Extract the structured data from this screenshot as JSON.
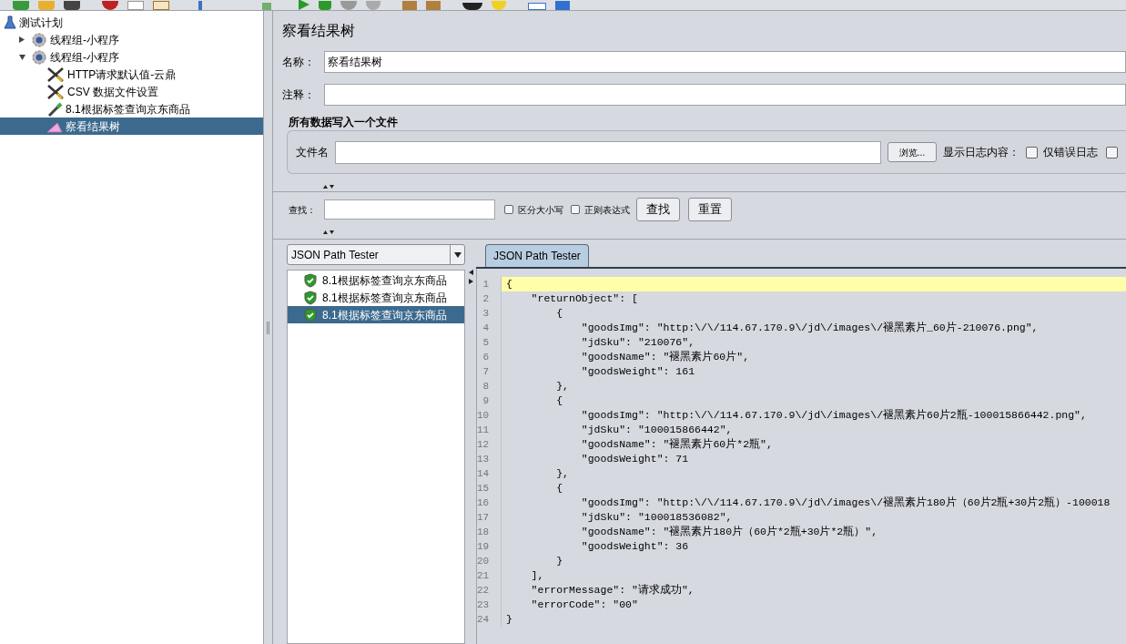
{
  "tree": [
    {
      "label": "测试计划",
      "kind": "plan",
      "selected": false,
      "children": [
        {
          "label": "线程组-小程序",
          "kind": "thread-group",
          "selected": false,
          "expanded": false
        },
        {
          "label": "线程组-小程序",
          "kind": "thread-group",
          "selected": false,
          "expanded": true,
          "children": [
            {
              "label": "HTTP请求默认值-云鼎",
              "kind": "config",
              "selected": false
            },
            {
              "label": "CSV 数据文件设置",
              "kind": "config",
              "selected": false
            },
            {
              "label": "8.1根据标签查询京东商品",
              "kind": "sampler",
              "selected": false
            },
            {
              "label": "察看结果树",
              "kind": "listener",
              "selected": true
            }
          ]
        }
      ]
    }
  ],
  "panel": {
    "title": "察看结果树",
    "name_field": {
      "label": "名称：",
      "value": "察看结果树"
    },
    "comment_field": {
      "label": "注释："
    },
    "file_section": {
      "title": "所有数据写入一个文件",
      "filename_label": "文件名",
      "browse_button": "浏览...",
      "log_label": "显示日志内容：",
      "checkboxes": [
        {
          "label": "仅错误日志",
          "checked": false
        },
        {
          "checked": false
        }
      ]
    },
    "search": {
      "label": "查找：",
      "checkboxes": [
        {
          "label": "区分大小写",
          "checked": false
        },
        {
          "label": "正则表达式",
          "checked": false
        }
      ],
      "buttons": [
        "查找",
        "重置"
      ]
    },
    "renderer_select": "JSON Path Tester",
    "results": [
      {
        "label": "8.1根据标签查询京东商品",
        "selected": false
      },
      {
        "label": "8.1根据标签查询京东商品",
        "selected": false
      },
      {
        "label": "8.1根据标签查询京东商品",
        "selected": true
      }
    ],
    "tabs": [
      {
        "label": "JSON Path Tester",
        "selected": true
      }
    ],
    "code_lines": [
      {
        "number": "1",
        "text": "{",
        "highlighted": true
      },
      {
        "number": "2",
        "text": "    \"returnObject\": [",
        "highlighted": false
      },
      {
        "number": "3",
        "text": "        {",
        "highlighted": false
      },
      {
        "number": "4",
        "text": "            \"goodsImg\": \"http:\\/\\/114.67.170.9\\/jd\\/images\\/褪黑素片_60片-210076.png\",",
        "highlighted": false
      },
      {
        "number": "5",
        "text": "            \"jdSku\": \"210076\",",
        "highlighted": false
      },
      {
        "number": "6",
        "text": "            \"goodsName\": \"褪黑素片60片\",",
        "highlighted": false
      },
      {
        "number": "7",
        "text": "            \"goodsWeight\": 161",
        "highlighted": false
      },
      {
        "number": "8",
        "text": "        },",
        "highlighted": false
      },
      {
        "number": "9",
        "text": "        {",
        "highlighted": false
      },
      {
        "number": "10",
        "text": "            \"goodsImg\": \"http:\\/\\/114.67.170.9\\/jd\\/images\\/褪黑素片60片2瓶-100015866442.png\",",
        "highlighted": false
      },
      {
        "number": "11",
        "text": "            \"jdSku\": \"100015866442\",",
        "highlighted": false
      },
      {
        "number": "12",
        "text": "            \"goodsName\": \"褪黑素片60片*2瓶\",",
        "highlighted": false
      },
      {
        "number": "13",
        "text": "            \"goodsWeight\": 71",
        "highlighted": false
      },
      {
        "number": "14",
        "text": "        },",
        "highlighted": false
      },
      {
        "number": "15",
        "text": "        {",
        "highlighted": false
      },
      {
        "number": "16",
        "text": "            \"goodsImg\": \"http:\\/\\/114.67.170.9\\/jd\\/images\\/褪黑素片180片（60片2瓶+30片2瓶）-100018",
        "highlighted": false
      },
      {
        "number": "17",
        "text": "            \"jdSku\": \"100018536082\",",
        "highlighted": false
      },
      {
        "number": "18",
        "text": "            \"goodsName\": \"褪黑素片180片（60片*2瓶+30片*2瓶）\",",
        "highlighted": false
      },
      {
        "number": "19",
        "text": "            \"goodsWeight\": 36",
        "highlighted": false
      },
      {
        "number": "20",
        "text": "        }",
        "highlighted": false
      },
      {
        "number": "21",
        "text": "    ],",
        "highlighted": false
      },
      {
        "number": "22",
        "text": "    \"errorMessage\": \"请求成功\",",
        "highlighted": false
      },
      {
        "number": "23",
        "text": "    \"errorCode\": \"00\"",
        "highlighted": false
      },
      {
        "number": "24",
        "text": "}",
        "highlighted": false
      }
    ]
  }
}
